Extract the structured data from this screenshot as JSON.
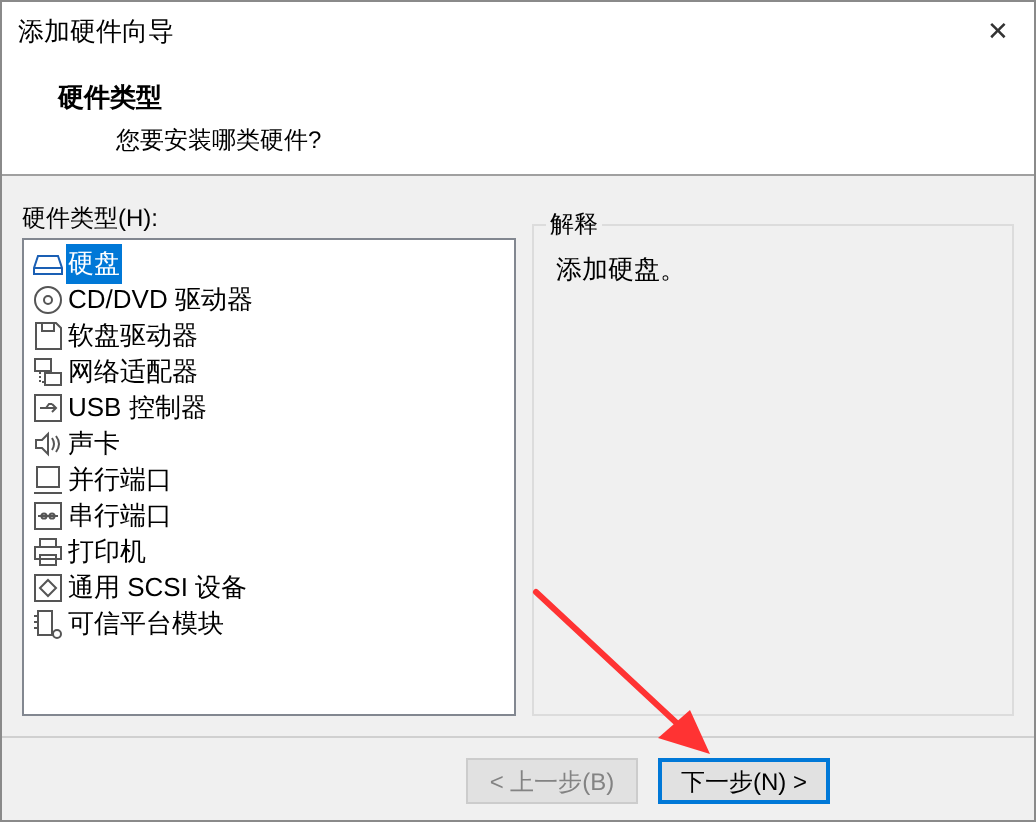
{
  "window": {
    "title": "添加硬件向导",
    "close": "✕"
  },
  "header": {
    "title": "硬件类型",
    "subtitle": "您要安装哪类硬件?"
  },
  "hardware_list": {
    "label": "硬件类型(H):",
    "items": [
      {
        "label": "硬盘",
        "kind": "disk",
        "selected": true
      },
      {
        "label": "CD/DVD 驱动器",
        "kind": "cdrom",
        "selected": false
      },
      {
        "label": "软盘驱动器",
        "kind": "floppy",
        "selected": false
      },
      {
        "label": "网络适配器",
        "kind": "network",
        "selected": false
      },
      {
        "label": "USB 控制器",
        "kind": "usb",
        "selected": false
      },
      {
        "label": "声卡",
        "kind": "sound",
        "selected": false
      },
      {
        "label": "并行端口",
        "kind": "parallel",
        "selected": false
      },
      {
        "label": "串行端口",
        "kind": "serial",
        "selected": false
      },
      {
        "label": "打印机",
        "kind": "printer",
        "selected": false
      },
      {
        "label": "通用 SCSI 设备",
        "kind": "scsi",
        "selected": false
      },
      {
        "label": "可信平台模块",
        "kind": "tpm",
        "selected": false
      }
    ]
  },
  "explanation": {
    "title": "解释",
    "text": "添加硬盘。"
  },
  "buttons": [
    {
      "label": "< 上一步(B)",
      "disabled": true,
      "default": false
    },
    {
      "label": "下一步(N) >",
      "disabled": false,
      "default": true
    }
  ]
}
